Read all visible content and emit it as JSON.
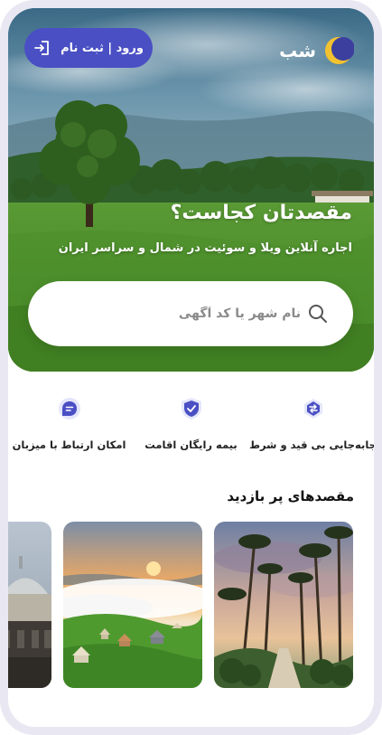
{
  "brand": {
    "name": "شب"
  },
  "header": {
    "login_label": "ورود | ثبت نام"
  },
  "hero": {
    "title": "مقصدتان کجاست؟",
    "subtitle": "اجاره آنلاین ویلا و سوئیت در شمال و سراسر ایران"
  },
  "search": {
    "placeholder": "نام شهر یا کد آگهی",
    "value": ""
  },
  "features": [
    {
      "label": "جابه‌جایی بی قید و شرط",
      "icon": "swap-icon"
    },
    {
      "label": "بیمه رایگان اقامت",
      "icon": "shield-check-icon"
    },
    {
      "label": "امکان ارتباط با میزبان",
      "icon": "chat-icon"
    }
  ],
  "destinations": {
    "title": "مقصدهای پر بازدید",
    "cards": [
      {
        "image": "palm-avenue-photo"
      },
      {
        "image": "misty-mountain-village-photo"
      },
      {
        "image": "domed-building-photo"
      }
    ]
  },
  "colors": {
    "accent": "#4a4fc4",
    "icon_bg": "#e4e6fb",
    "logo_yellow": "#f2c230"
  }
}
